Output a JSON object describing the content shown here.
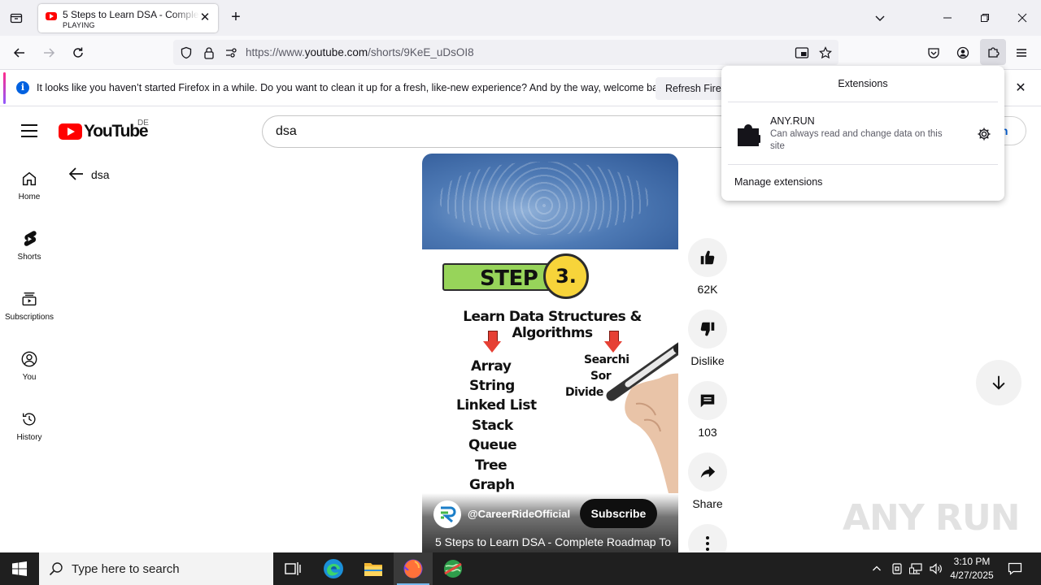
{
  "browser": {
    "tab": {
      "title": "5 Steps to Learn DSA - Complete Roadmap To",
      "status": "PLAYING",
      "close": "✕"
    },
    "new_tab": "+",
    "url": {
      "prefix": "https://www.",
      "host": "youtube.com",
      "path": "/shorts/9KeE_uDsOI8"
    },
    "notification": {
      "message": "It looks like you haven’t started Firefox in a while. Do you want to clean it up for a fresh, like-new experience? And by the way, welcome back!",
      "button": "Refresh Firefox",
      "close": "✕"
    },
    "extensions_panel": {
      "title": "Extensions",
      "items": [
        {
          "name": "ANY.RUN",
          "description": "Can always read and change data on this site"
        }
      ],
      "manage": "Manage extensions"
    }
  },
  "youtube": {
    "logo": "YouTube",
    "region": "DE",
    "search_value": "dsa",
    "signin": "in",
    "sidebar": [
      {
        "label": "Home"
      },
      {
        "label": "Shorts"
      },
      {
        "label": "Subscriptions"
      },
      {
        "label": "You"
      },
      {
        "label": "History"
      }
    ],
    "back_label": "dsa",
    "short": {
      "step_word": "STEP",
      "step_number": "3.",
      "heading": "Learn Data Structures & Algorithms",
      "left_topics": [
        "Array",
        "String",
        "Linked List",
        "Stack",
        "Queue",
        "Tree",
        "Graph"
      ],
      "right_topics": [
        "Searchi",
        "Sor",
        "Divide"
      ],
      "channel": "@CareerRideOfficial",
      "subscribe": "Subscribe",
      "title": "5 Steps to Learn DSA - Complete Roadmap To"
    },
    "actions": [
      {
        "icon": "thumb-up-icon",
        "label": "62K"
      },
      {
        "icon": "thumb-down-icon",
        "label": "Dislike"
      },
      {
        "icon": "comment-icon",
        "label": "103"
      },
      {
        "icon": "share-icon",
        "label": "Share"
      },
      {
        "icon": "more-icon",
        "label": ""
      }
    ]
  },
  "watermark": "ANY RUN",
  "taskbar": {
    "search_placeholder": "Type here to search",
    "time": "3:10 PM",
    "date": "4/27/2025"
  },
  "colors": {
    "youtube_red": "#ff0000",
    "step_green": "#97d45a",
    "step_yellow": "#f7d43a",
    "arrow_red": "#e64034",
    "link_blue": "#065fd4"
  }
}
